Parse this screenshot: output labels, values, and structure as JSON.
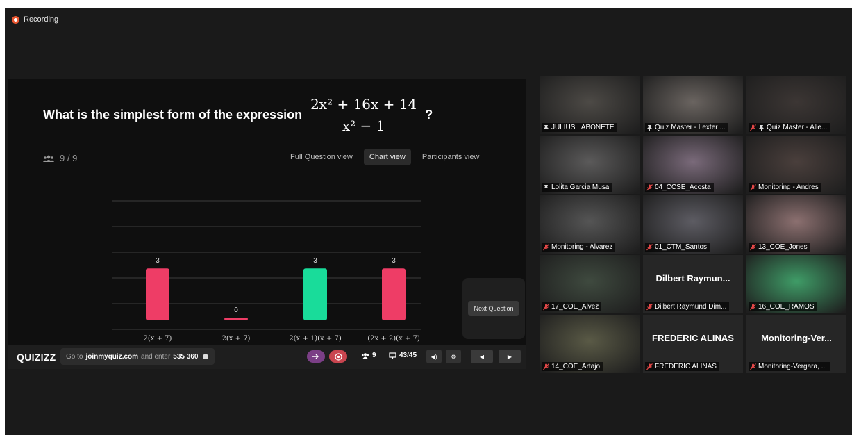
{
  "recording": {
    "label": "Recording"
  },
  "presentation": {
    "question_text": "What is the simplest form of the expression",
    "fraction_num": "2x² + 16x + 14",
    "fraction_den": "x² − 1",
    "question_mark": "?",
    "participant_count": "9 / 9",
    "views": [
      "Full Question view",
      "Chart view",
      "Participants view"
    ],
    "active_view": "Chart view",
    "next_button": "Next Question"
  },
  "chart_data": {
    "type": "bar",
    "categories": [
      "2(x + 7)",
      "2(x + 7)",
      "2(x + 1)(x + 7)",
      "(2x + 2)(x + 7)"
    ],
    "values": [
      3,
      0,
      3,
      3
    ],
    "colors": [
      "#ee3d66",
      "#ee3d66",
      "#19dc9a",
      "#ee3d66"
    ],
    "ylim": [
      0,
      3
    ],
    "grid": true
  },
  "bottombar": {
    "logo": "QUIZIZZ",
    "goto_prefix": "Go to",
    "goto_site": "joinmyquiz.com",
    "goto_mid": "and enter",
    "code": "535 360",
    "players": "9",
    "progress": "43/45"
  },
  "participants": [
    {
      "name": "JULIUS LABONETE",
      "muted": false,
      "pinned": true,
      "video": true
    },
    {
      "name": "Quiz Master - Lexter ...",
      "muted": false,
      "pinned": true,
      "video": true,
      "speaker": true
    },
    {
      "name": "Quiz Master - Alle...",
      "muted": true,
      "pinned": true,
      "video": true
    },
    {
      "name": "Lolita Garcia Musa",
      "muted": false,
      "pinned": true,
      "video": true
    },
    {
      "name": "04_CCSE_Acosta",
      "muted": true,
      "pinned": false,
      "video": true
    },
    {
      "name": "Monitoring - Andres",
      "muted": true,
      "pinned": false,
      "video": true
    },
    {
      "name": "Monitoring - Alvarez",
      "muted": true,
      "pinned": false,
      "video": true
    },
    {
      "name": "01_CTM_Santos",
      "muted": true,
      "pinned": false,
      "video": true
    },
    {
      "name": "13_COE_Jones",
      "muted": true,
      "pinned": false,
      "video": true
    },
    {
      "name": "17_COE_Alvez",
      "muted": true,
      "pinned": false,
      "video": true
    },
    {
      "name": "Dilbert Raymund Dim...",
      "muted": true,
      "pinned": false,
      "video": false,
      "display": "Dilbert  Raymun..."
    },
    {
      "name": "16_COE_RAMOS",
      "muted": true,
      "pinned": false,
      "video": true
    },
    {
      "name": "14_COE_Artajo",
      "muted": true,
      "pinned": false,
      "video": true
    },
    {
      "name": "FREDERIC ALINAS",
      "muted": true,
      "pinned": false,
      "video": false,
      "display": "FREDERIC ALINAS"
    },
    {
      "name": "Monitoring-Vergara, ...",
      "muted": true,
      "pinned": false,
      "video": false,
      "display": "Monitoring-Ver..."
    }
  ]
}
